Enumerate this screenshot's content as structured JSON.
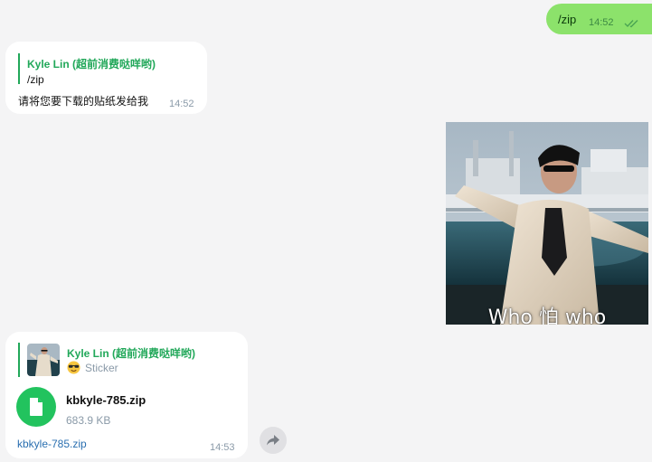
{
  "messages": {
    "outgoing": {
      "text": "/zip",
      "time": "14:52",
      "status_icon": "double-check-icon"
    },
    "incoming_reply": {
      "quote": {
        "sender": "Kyle Lin (超前消费哒咩哟)",
        "text": "/zip"
      },
      "text": "请将您要下载的贴纸发给我",
      "time": "14:52"
    },
    "sticker": {
      "caption": "Who 怕 who"
    },
    "incoming_file": {
      "quote": {
        "sender": "Kyle Lin (超前消费哒咩哟)",
        "emoji": "😎",
        "text": "Sticker"
      },
      "file": {
        "name": "kbkyle-785.zip",
        "size": "683.9 KB",
        "icon": "file-icon"
      },
      "caption": "kbkyle-785.zip",
      "time": "14:53"
    }
  },
  "forward_button": {
    "icon": "forward-arrow-icon"
  },
  "colors": {
    "background": "#f4f4f5",
    "outgoing_bubble": "#8ce26b",
    "accent_green": "#22a85a",
    "file_icon": "#22c35e",
    "link": "#2a6fb0"
  }
}
